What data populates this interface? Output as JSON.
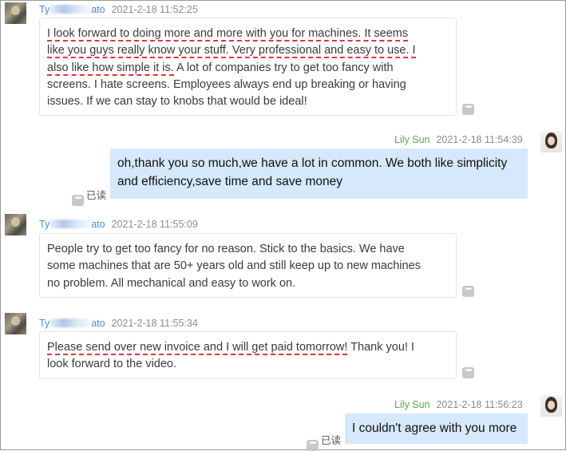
{
  "messages": [
    {
      "side": "in",
      "sender": "Ty  ato",
      "sender_prefix": "Ty",
      "sender_suffix": "ato",
      "time": "2021-2-18 11:52:25",
      "lines": [
        "I look forward to doing more and more with you for machines. It seems",
        "like you guys really know your stuff. Very professional and easy to use. I",
        "also like how simple it is.",
        " A lot of companies try to get too fancy with",
        "screens. I hate screens. Employees always end up breaking or having",
        "issues. If we can stay to knobs that would be ideal!"
      ]
    },
    {
      "side": "out",
      "sender": "Lily Sun",
      "time": "2021-2-18 11:54:39",
      "lines": [
        "oh,thank you so much,we have a lot in common. We both like simplicity",
        " and efficiency,save time and save money"
      ],
      "read_label": "已读"
    },
    {
      "side": "in",
      "sender_prefix": "Ty",
      "sender_suffix": "ato",
      "time": "2021-2-18 11:55:09",
      "lines": [
        "People try to get too fancy for no reason. Stick to the basics. We have",
        "some machines that are 50+ years old and still keep up to new machines",
        "no problem. All mechanical and easy to work on."
      ]
    },
    {
      "side": "in",
      "sender_prefix": "Ty",
      "sender_suffix": "ato",
      "time": "2021-2-18 11:55:34",
      "lines": [
        "Please send over new invoice and I will get paid tomorrow!",
        " Thank you! I",
        "look forward to the video."
      ]
    },
    {
      "side": "out",
      "sender": "Lily Sun",
      "time": "2021-2-18 11:56:23",
      "lines": [
        "I couldn't agree with you more"
      ],
      "read_label": "已读"
    }
  ],
  "more_glyph": "•••",
  "colors": {
    "incoming_name": "#4a8ad8",
    "outgoing_name": "#5aa84a",
    "outgoing_bubble": "#d6e8fb",
    "underline": "#e2343a"
  }
}
